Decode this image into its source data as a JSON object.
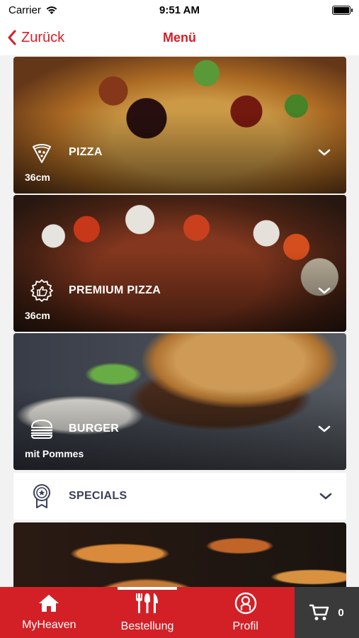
{
  "status": {
    "carrier": "Carrier",
    "time": "9:51 AM"
  },
  "nav": {
    "back_label": "Zurück",
    "title": "Menü"
  },
  "categories": [
    {
      "title": "PIZZA",
      "subtitle": "36cm"
    },
    {
      "title": "PREMIUM PIZZA",
      "subtitle": "36cm"
    },
    {
      "title": "BURGER",
      "subtitle": "mit Pommes"
    }
  ],
  "specials": {
    "title": "SPECIALS"
  },
  "tabbar": {
    "tabs": [
      {
        "label": "MyHeaven"
      },
      {
        "label": "Bestellung"
      },
      {
        "label": "Profil"
      }
    ],
    "cart_count": "0"
  },
  "colors": {
    "accent": "#d32027",
    "cart_bg": "#3a3a3a",
    "specials_text": "#3a3f5a"
  }
}
